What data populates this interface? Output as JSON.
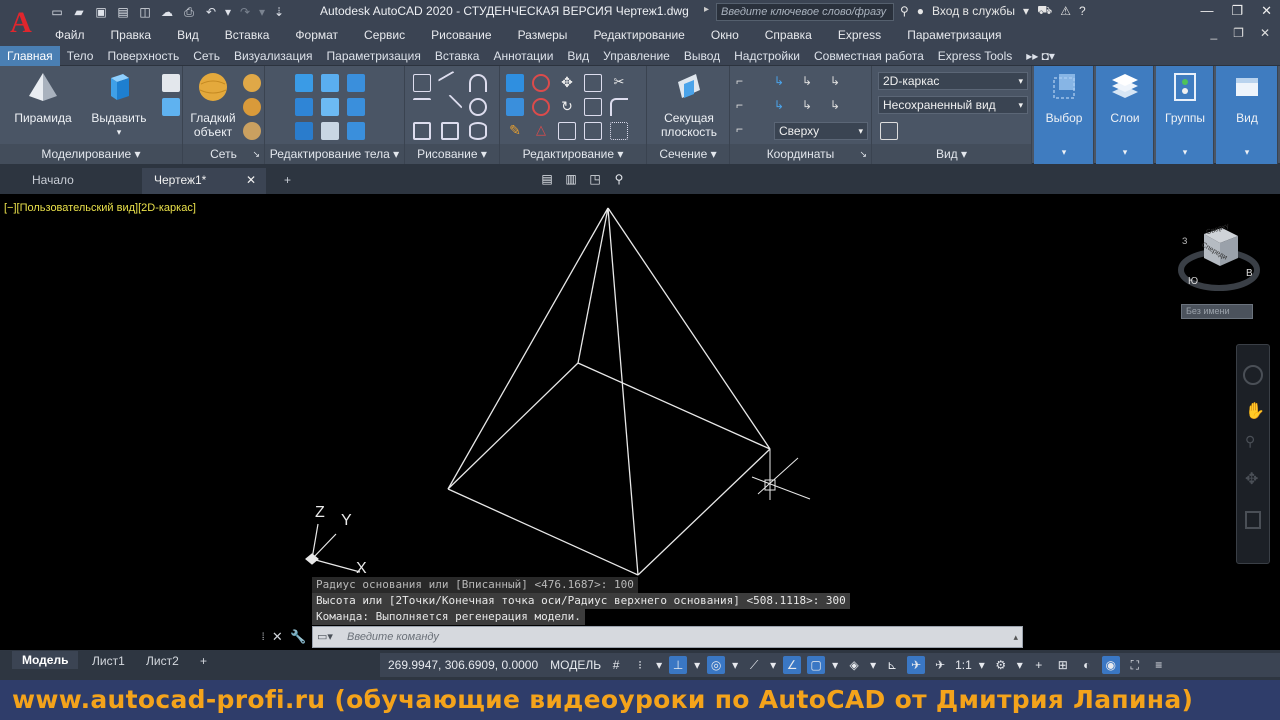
{
  "window": {
    "title": "Autodesk AutoCAD 2020 - СТУДЕНЧЕСКАЯ ВЕРСИЯ   Чертеж1.dwg",
    "search_placeholder": "Введите ключевое слово/фразу",
    "signin": "Вход в службы",
    "app_logo": "A"
  },
  "menu": [
    "Файл",
    "Правка",
    "Вид",
    "Вставка",
    "Формат",
    "Сервис",
    "Рисование",
    "Размеры",
    "Редактирование",
    "Окно",
    "Справка",
    "Express",
    "Параметризация"
  ],
  "ribbon_tabs": [
    "Главная",
    "Тело",
    "Поверхность",
    "Сеть",
    "Визуализация",
    "Параметризация",
    "Вставка",
    "Аннотации",
    "Вид",
    "Управление",
    "Вывод",
    "Надстройки",
    "Совместная работа",
    "Express Tools"
  ],
  "ribbon": {
    "modeling": {
      "footer": "Моделирование ▾",
      "pyramid": "Пирамида",
      "extrude": "Выдавить"
    },
    "mesh": {
      "footer": "Сеть",
      "smooth_line1": "Гладкий",
      "smooth_line2": "объект"
    },
    "solid_edit": {
      "footer": "Редактирование тела ▾"
    },
    "draw": {
      "footer": "Рисование ▾"
    },
    "modify": {
      "footer": "Редактирование ▾"
    },
    "section": {
      "footer": "Сечение ▾",
      "plane_line1": "Секущая",
      "plane_line2": "плоскость"
    },
    "coords": {
      "footer": "Координаты",
      "view_dropdown": "Сверху"
    },
    "view": {
      "footer": "Вид ▾",
      "visual_style": "2D-каркас",
      "named_view": "Несохраненный вид"
    },
    "selection": {
      "label": "Выбор"
    },
    "layers": {
      "label": "Слои"
    },
    "groups": {
      "label": "Группы"
    },
    "viewpanel": {
      "label": "Вид"
    }
  },
  "doc_tabs": {
    "start": "Начало",
    "drawing": "Чертеж1*",
    "close": "✕",
    "add": "+"
  },
  "viewport": {
    "label": "[−][Пользовательский вид][2D-каркас]",
    "ucs_x": "X",
    "ucs_y": "Y",
    "ucs_z": "Z",
    "viewcube_top": "Сверху",
    "viewcube_front": "Спереди",
    "compass_s": "Ю",
    "compass_e": "В",
    "compass_w": "З",
    "named": "Без имени"
  },
  "command": {
    "history": [
      "Радиус основания или [Вписанный] <476.1687>: 100",
      "Высота или [2Точки/Конечная точка оси/Радиус верхнего основания] <508.1118>: 300",
      "Команда:  Выполняется регенерация модели."
    ],
    "placeholder": "Введите команду"
  },
  "status": {
    "layouts": [
      "Модель",
      "Лист1",
      "Лист2"
    ],
    "add": "+",
    "coords": "269.9947, 306.6909, 0.0000",
    "space": "МОДЕЛЬ",
    "scale": "1:1"
  },
  "watermark": "www.autocad-profi.ru  (обучающие видеоуроки по AutoCAD от Дмитрия Лапина)"
}
